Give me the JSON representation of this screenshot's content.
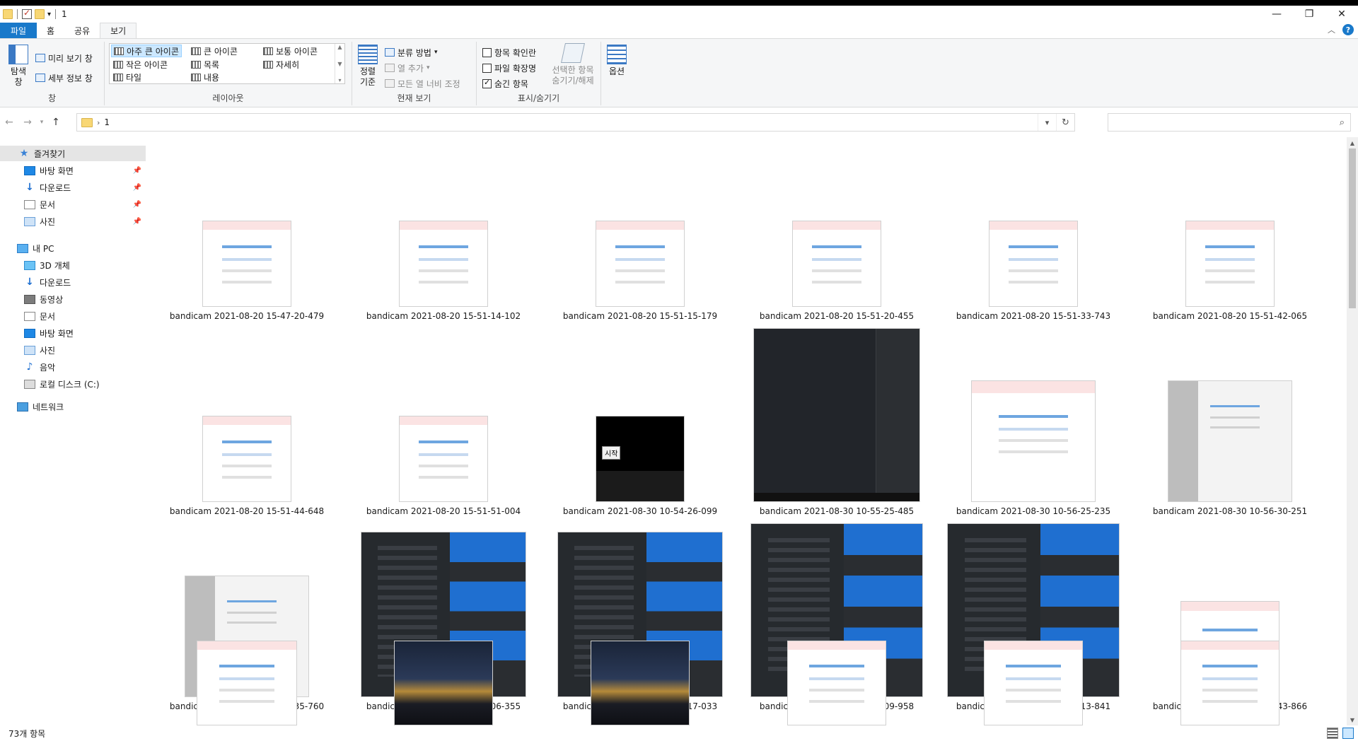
{
  "window": {
    "title": "1",
    "controls": {
      "minimize": "—",
      "maximize": "❐",
      "close": "✕"
    }
  },
  "ribbon_tabs": [
    "파일",
    "홈",
    "공유",
    "보기"
  ],
  "ribbon": {
    "pane_group": {
      "label": "창",
      "navigation_pane": "탐색\n창",
      "preview_pane": "미리 보기 창",
      "details_pane": "세부 정보 창"
    },
    "layout_group": {
      "label": "레이아웃",
      "items": [
        "아주 큰 아이콘",
        "큰 아이콘",
        "보통 아이콘",
        "작은 아이콘",
        "목록",
        "자세히",
        "타일",
        "내용"
      ]
    },
    "current_view_group": {
      "label": "현재 보기",
      "sort_by": "정렬\n기준",
      "group_by": "분류 방법",
      "add_columns": "열 추가",
      "size_columns": "모든 열 너비 조정"
    },
    "show_hide_group": {
      "label": "표시/숨기기",
      "item_checkboxes": "항목 확인란",
      "file_extensions": "파일 확장명",
      "hidden_items": "숨긴 항목",
      "hide_selected": "선택한 항목\n숨기기/해제"
    },
    "options": "옵션"
  },
  "address": {
    "path": "1"
  },
  "nav_pane": {
    "quick_access": "즐겨찾기",
    "quick_items": [
      "바탕 화면",
      "다운로드",
      "문서",
      "사진"
    ],
    "this_pc": "내 PC",
    "pc_items": [
      "3D 개체",
      "다운로드",
      "동영상",
      "문서",
      "바탕 화면",
      "사진",
      "음악",
      "로컬 디스크 (C:)"
    ],
    "network": "네트워크"
  },
  "files": [
    {
      "name": "bandicam 2021-08-20 15-47-20-479",
      "style": "light"
    },
    {
      "name": "bandicam 2021-08-20 15-51-14-102",
      "style": "light"
    },
    {
      "name": "bandicam 2021-08-20 15-51-15-179",
      "style": "light"
    },
    {
      "name": "bandicam 2021-08-20 15-51-20-455",
      "style": "light"
    },
    {
      "name": "bandicam 2021-08-20 15-51-33-743",
      "style": "light"
    },
    {
      "name": "bandicam 2021-08-20 15-51-42-065",
      "style": "light"
    },
    {
      "name": "bandicam 2021-08-20 15-51-44-648",
      "style": "light"
    },
    {
      "name": "bandicam 2021-08-20 15-51-51-004",
      "style": "light"
    },
    {
      "name": "bandicam 2021-08-30 10-54-26-099",
      "style": "taskbar",
      "tooltip": "시작"
    },
    {
      "name": "bandicam 2021-08-30 10-55-25-485",
      "style": "dark"
    },
    {
      "name": "bandicam 2021-08-30 10-56-25-235",
      "style": "light"
    },
    {
      "name": "bandicam 2021-08-30 10-56-30-251",
      "style": "gray"
    },
    {
      "name": "bandicam 2021-08-30 10-56-35-760",
      "style": "gray"
    },
    {
      "name": "bandicam 2021-08-30 11-06-06-355",
      "style": "start"
    },
    {
      "name": "bandicam 2021-08-30 11-06-17-033",
      "style": "start"
    },
    {
      "name": "bandicam 2021-08-30 11-07-09-958",
      "style": "start"
    },
    {
      "name": "bandicam 2021-08-30 11-07-13-841",
      "style": "start"
    },
    {
      "name": "bandicam 2021-08-30 11-08-43-866",
      "style": "light"
    },
    {
      "name": "",
      "style": "light"
    },
    {
      "name": "",
      "style": "photo"
    },
    {
      "name": "",
      "style": "photo"
    },
    {
      "name": "",
      "style": "light"
    },
    {
      "name": "",
      "style": "light"
    },
    {
      "name": "",
      "style": "light"
    }
  ],
  "status": {
    "count": "73개 항목"
  },
  "colors": {
    "accent": "#1979ca",
    "ribbon_bg": "#f5f6f7",
    "selection": "#cce8ff"
  }
}
